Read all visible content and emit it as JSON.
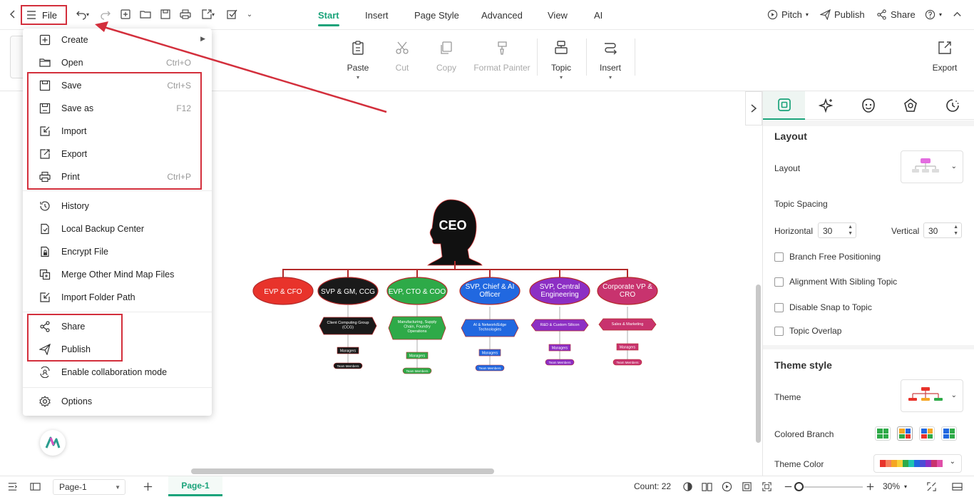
{
  "topbar": {
    "file_label": "File",
    "tabs": [
      {
        "label": "Start",
        "active": true
      },
      {
        "label": "Insert",
        "active": false
      },
      {
        "label": "Page Style",
        "active": false
      },
      {
        "label": "Advanced",
        "active": false
      },
      {
        "label": "View",
        "active": false
      },
      {
        "label": "AI",
        "active": false
      }
    ],
    "right": {
      "pitch": "Pitch",
      "publish": "Publish",
      "share": "Share"
    }
  },
  "ribbon": {
    "paste": "Paste",
    "cut": "Cut",
    "copy": "Copy",
    "format_painter": "Format Painter",
    "topic": "Topic",
    "insert": "Insert",
    "export": "Export"
  },
  "file_menu": {
    "items": [
      {
        "label": "Create",
        "shortcut": "",
        "icon": "plus-square-icon"
      },
      {
        "label": "Open",
        "shortcut": "Ctrl+O",
        "icon": "folder-icon"
      },
      {
        "label": "Save",
        "shortcut": "Ctrl+S",
        "icon": "save-icon"
      },
      {
        "label": "Save as",
        "shortcut": "F12",
        "icon": "save-as-icon"
      },
      {
        "label": "Import",
        "shortcut": "",
        "icon": "import-icon"
      },
      {
        "label": "Export",
        "shortcut": "",
        "icon": "export-icon"
      },
      {
        "label": "Print",
        "shortcut": "Ctrl+P",
        "icon": "printer-icon"
      },
      {
        "label": "History",
        "shortcut": "",
        "icon": "history-icon"
      },
      {
        "label": "Local Backup Center",
        "shortcut": "",
        "icon": "backup-icon"
      },
      {
        "label": "Encrypt File",
        "shortcut": "",
        "icon": "lock-file-icon"
      },
      {
        "label": "Merge Other Mind Map Files",
        "shortcut": "",
        "icon": "merge-icon"
      },
      {
        "label": "Import Folder Path",
        "shortcut": "",
        "icon": "folder-import-icon"
      },
      {
        "label": "Share",
        "shortcut": "",
        "icon": "share-icon"
      },
      {
        "label": "Publish",
        "shortcut": "",
        "icon": "publish-icon"
      },
      {
        "label": "Enable collaboration mode",
        "shortcut": "",
        "icon": "collaboration-icon"
      },
      {
        "label": "Options",
        "shortcut": "",
        "icon": "gear-icon"
      }
    ]
  },
  "mindmap": {
    "root": "CEO",
    "branches": [
      {
        "title": "EVP & CFO",
        "color": "#e8332b",
        "sub": "",
        "mgr": "",
        "team": ""
      },
      {
        "title": "SVP & GM, CCG",
        "color": "#1a1a1a",
        "sub": "Client Computing Group (CCG)",
        "mgr": "Managers",
        "team": "Team Members"
      },
      {
        "title": "EVP, CTO & COO",
        "color": "#2eaa48",
        "sub": "Manufacturing, Supply Chain, Foundry Operations",
        "mgr": "Managers",
        "team": "Team Members"
      },
      {
        "title": "SVP, Chief & AI Officer",
        "color": "#2168e0",
        "sub": "AI & Network/Edge Technologies",
        "mgr": "Managers",
        "team": "Team Members"
      },
      {
        "title": "SVP, Central Engineering",
        "color": "#8c2fc4",
        "sub": "R&D & Custom Silicon",
        "mgr": "Managers",
        "team": "Team Members"
      },
      {
        "title": "Corporate VP & CRO",
        "color": "#c8336e",
        "sub": "Sales & Marketing",
        "mgr": "Managers",
        "team": "Team Members"
      }
    ]
  },
  "right_panel": {
    "layout_heading": "Layout",
    "layout_label": "Layout",
    "topic_spacing": "Topic Spacing",
    "horizontal_label": "Horizontal",
    "horizontal_value": "30",
    "vertical_label": "Vertical",
    "vertical_value": "30",
    "checkboxes": [
      "Branch Free Positioning",
      "Alignment With Sibling Topic",
      "Disable Snap to Topic",
      "Topic Overlap"
    ],
    "theme_style_heading": "Theme style",
    "theme_label": "Theme",
    "colored_branch_label": "Colored Branch",
    "theme_color_label": "Theme Color"
  },
  "statusbar": {
    "page_select": "Page-1",
    "page_tab": "Page-1",
    "count": "Count: 22",
    "zoom": "30%"
  },
  "colors": {
    "accent": "#1aa37a",
    "annotation_red": "#d32f3c"
  }
}
